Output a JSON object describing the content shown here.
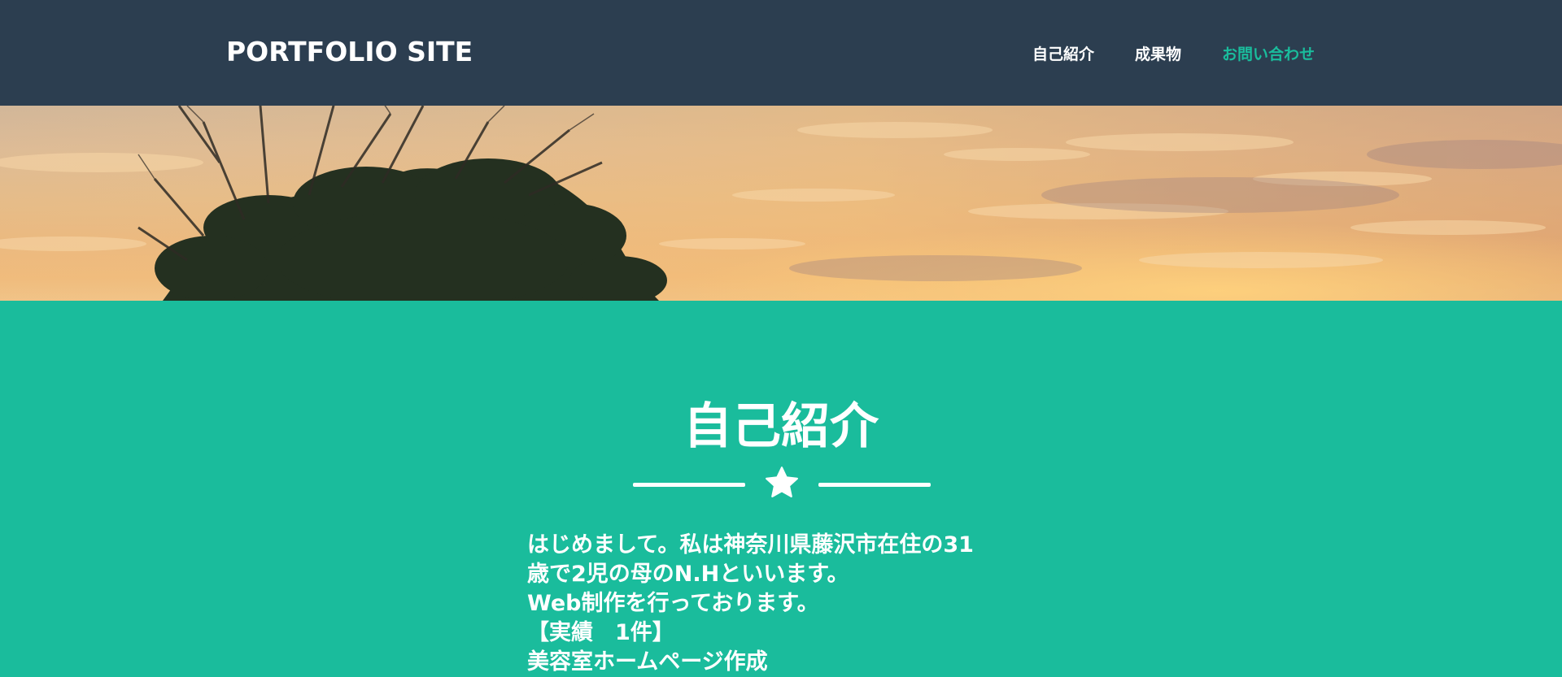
{
  "navbar": {
    "brand": "PORTFOLIO SITE",
    "links": [
      {
        "label": "自己紹介",
        "active": false
      },
      {
        "label": "成果物",
        "active": false
      },
      {
        "label": "お問い合わせ",
        "active": true
      }
    ]
  },
  "hero": {
    "image_description_icon": "sunset-tree-photo"
  },
  "about": {
    "title": "自己紹介",
    "divider_icon": "star-icon",
    "lines": [
      "はじめまして。私は神奈川県藤沢市在住の31",
      "歳で2児の母のN.Hといいます。",
      "Web制作を行っております。",
      "【実績　1件】",
      "美容室ホームページ作成"
    ]
  },
  "colors": {
    "navbar_bg": "#2c3e50",
    "accent": "#1abc9c",
    "text": "#ffffff"
  }
}
